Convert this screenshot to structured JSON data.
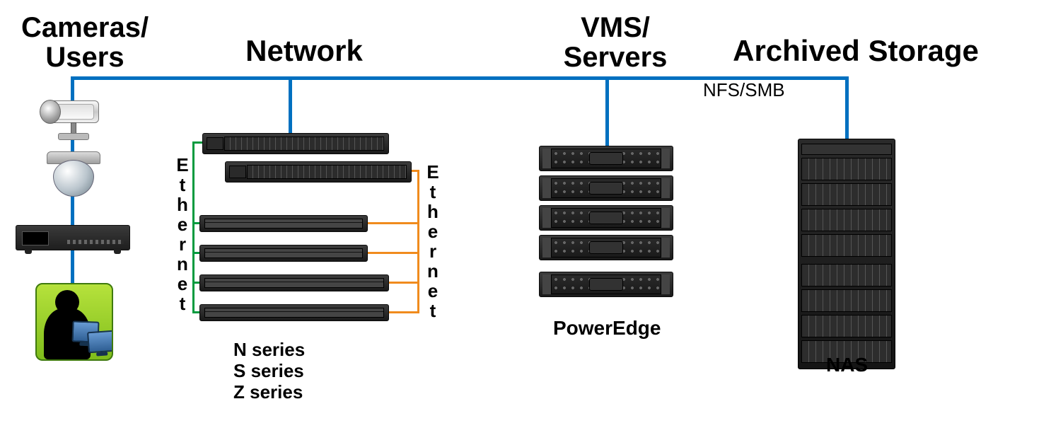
{
  "headings": {
    "cameras_users": "Cameras/\nUsers",
    "network": "Network",
    "vms_servers": "VMS/\nServers",
    "archived_storage": "Archived Storage"
  },
  "labels": {
    "ethernet_left": "Ethernet",
    "ethernet_right": "Ethernet",
    "nfs_smb": "NFS/SMB"
  },
  "sublabels": {
    "network_series": "N series\nS series\nZ series",
    "servers": "PowerEdge",
    "storage": "NAS"
  },
  "colors": {
    "bus_blue": "#0070c0",
    "eth_green": "#009a3e",
    "eth_orange": "#f08b1d"
  },
  "counts": {
    "top_switches": 2,
    "bottom_switches": 4,
    "servers": 5,
    "nas_units": 8
  }
}
